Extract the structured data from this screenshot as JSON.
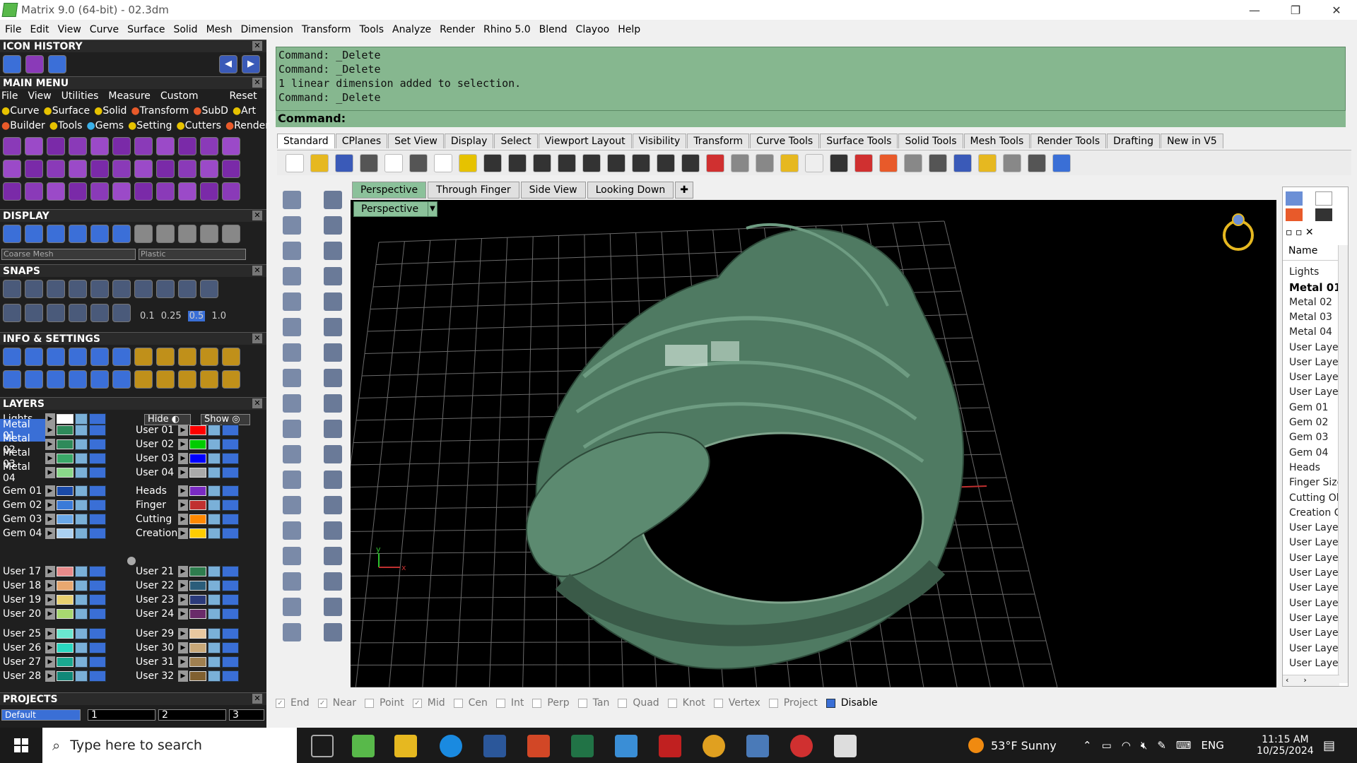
{
  "window": {
    "title": "Matrix 9.0 (64-bit) - 02.3dm",
    "controls": [
      "—",
      "❐",
      "✕"
    ]
  },
  "menubar": [
    "File",
    "Edit",
    "View",
    "Curve",
    "Surface",
    "Solid",
    "Mesh",
    "Dimension",
    "Transform",
    "Tools",
    "Analyze",
    "Render",
    "Rhino 5.0",
    "Blend",
    "Clayoo",
    "Help"
  ],
  "left_panel": {
    "icon_history": "ICON HISTORY",
    "main_menu": "MAIN MENU",
    "main_menu_items": [
      "File",
      "View",
      "Utilities",
      "Measure",
      "Custom",
      "Reset"
    ],
    "categories_row1": [
      "Curve",
      "Surface",
      "Solid",
      "Transform",
      "SubD",
      "Art"
    ],
    "categories_row2": [
      "Builder",
      "Tools",
      "Gems",
      "Setting",
      "Cutters",
      "Render"
    ],
    "display": "DISPLAY",
    "display_dropdowns": [
      "Coarse Mesh",
      "Plastic"
    ],
    "snaps": "SNAPS",
    "snap_values": [
      "0.1",
      "0.25",
      "0.5",
      "1.0"
    ],
    "info": "INFO & SETTINGS",
    "layers": "LAYERS",
    "layers_header": {
      "first": "Lights",
      "hide": "Hide",
      "show": "Show"
    },
    "layers_left": [
      "Metal 01",
      "Metal 02",
      "Metal 03",
      "Metal 04",
      "Gem 01",
      "Gem 02",
      "Gem 03",
      "Gem 04",
      "User 17",
      "User 18",
      "User 19",
      "User 20",
      "User 25",
      "User 26",
      "User 27",
      "User 28"
    ],
    "layers_right": [
      "User 01",
      "User 02",
      "User 03",
      "User 04",
      "Heads",
      "Finger",
      "Cutting",
      "Creation",
      "User 21",
      "User 22",
      "User 23",
      "User 24",
      "User 29",
      "User 30",
      "User 31",
      "User 32"
    ],
    "layers_right_colors": [
      "#ff0000",
      "#00cc00",
      "#0000ff",
      "#aaaaaa",
      "#7a2bc2",
      "#c03030",
      "#ff8800",
      "#ffcc00",
      "#2e7d4e",
      "#2b5d7a",
      "#2b3a7a",
      "#6a2b6a",
      "#e8c8a0",
      "#c8a878",
      "#a08050",
      "#806030"
    ],
    "projects": "PROJECTS",
    "project_default": "Default",
    "project_tabs": [
      "1",
      "2",
      "3"
    ]
  },
  "command": {
    "lines": [
      "Command: _Delete",
      "Command: _Delete",
      "1 linear dimension added to selection.",
      "Command: _Delete"
    ],
    "prompt": "Command:"
  },
  "toolbar_tabs": [
    "Standard",
    "CPlanes",
    "Set View",
    "Display",
    "Select",
    "Viewport Layout",
    "Visibility",
    "Transform",
    "Curve Tools",
    "Surface Tools",
    "Solid Tools",
    "Mesh Tools",
    "Render Tools",
    "Drafting",
    "New in V5"
  ],
  "viewport_tabs": [
    "Perspective",
    "Through Finger",
    "Side View",
    "Looking Down"
  ],
  "viewport_label": "Perspective",
  "right_panel": {
    "header": "Name",
    "items": [
      "Lights",
      "Metal 01",
      "Metal 02",
      "Metal 03",
      "Metal 04",
      "User Layer",
      "User Layer",
      "User Layer",
      "User Layer",
      "Gem 01",
      "Gem 02",
      "Gem 03",
      "Gem 04",
      "Heads",
      "Finger Size",
      "Cutting Obj",
      "Creation Cu",
      "User Layer",
      "User Layer",
      "User Layer",
      "User Layer",
      "User Layer",
      "User Layer",
      "User Layer",
      "User Layer",
      "User Layer",
      "User Layer"
    ]
  },
  "osnap": {
    "items": [
      "End",
      "Near",
      "Point",
      "Mid",
      "Cen",
      "Int",
      "Perp",
      "Tan",
      "Quad",
      "Knot",
      "Vertex",
      "Project",
      "Disable"
    ],
    "checked": [
      "End",
      "Near",
      "Mid"
    ]
  },
  "taskbar": {
    "search_placeholder": "Type here to search",
    "weather": "53°F  Sunny",
    "language": "ENG",
    "time": "11:15 AM",
    "date": "10/25/2024"
  },
  "colors": {
    "command_bg": "#86b78f",
    "viewport_bg": "#000000",
    "ring": "#4f7a62",
    "active_tab": "#8bc19a"
  }
}
